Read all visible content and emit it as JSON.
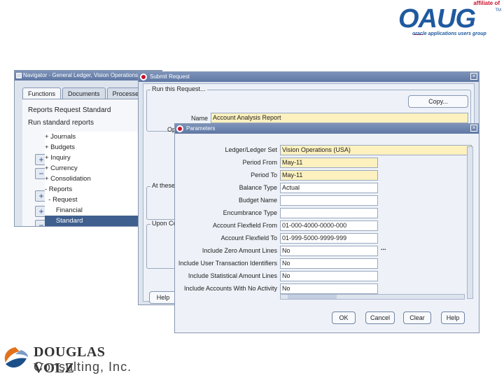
{
  "branding": {
    "oaug_affiliate": "affiliate of",
    "oaug_name": "OAUG",
    "oaug_tm": "TM",
    "oaug_tagline": "oracle applications users group",
    "consultant_name": "DOUGLAS VOLZ",
    "consultant_sub": "Consulting, Inc."
  },
  "navigator": {
    "title": "Navigator - General Ledger, Vision Operations",
    "tabs": [
      "Functions",
      "Documents",
      "Processes"
    ],
    "line1": "Reports Request Standard",
    "line2": "Run standard reports",
    "tree": [
      "+ Journals",
      "+ Budgets",
      "+ Inquiry",
      "+ Currency",
      "+ Consolidation",
      "- Reports",
      "  - Request",
      "      Financial",
      "      Standard"
    ],
    "selected_index": 8
  },
  "submit": {
    "title": "Submit Request",
    "section_run": "Run this Request...",
    "copy_label": "Copy...",
    "name_label": "Name",
    "name_value": "Account Analysis Report",
    "op_label": "Op",
    "at_these_label": "At these",
    "upon_label": "Upon Co",
    "help_label": "Help"
  },
  "parameters": {
    "title": "Parameters",
    "rows": [
      {
        "label": "Ledger/Ledger Set",
        "value": "Vision Operations (USA)",
        "required": true
      },
      {
        "label": "Period From",
        "value": "May-11",
        "required": true
      },
      {
        "label": "Period To",
        "value": "May-11",
        "required": true
      },
      {
        "label": "Balance Type",
        "value": "Actual",
        "required": false
      },
      {
        "label": "Budget Name",
        "value": "",
        "required": false
      },
      {
        "label": "Encumbrance Type",
        "value": "",
        "required": false
      },
      {
        "label": "Account Flexfield From",
        "value": "01-000-4000-0000-000",
        "required": false
      },
      {
        "label": "Account Flexfield To",
        "value": "01-999-5000-9999-999",
        "required": false
      },
      {
        "label": "Include Zero Amount Lines",
        "value": "No",
        "required": false
      },
      {
        "label": "Include User Transaction Identifiers",
        "value": "No",
        "required": false
      },
      {
        "label": "Include Statistical Amount Lines",
        "value": "No",
        "required": false
      },
      {
        "label": "Include Accounts With No Activity",
        "value": "No",
        "required": false
      }
    ],
    "ellipsis": "...",
    "buttons": {
      "ok": "OK",
      "cancel": "Cancel",
      "clear": "Clear",
      "help": "Help"
    }
  },
  "colors": {
    "required_field": "#fdf1bf",
    "title_bar": "#5e77a3",
    "selection": "#3f5f8f",
    "oaug_blue": "#1f5aa0"
  }
}
